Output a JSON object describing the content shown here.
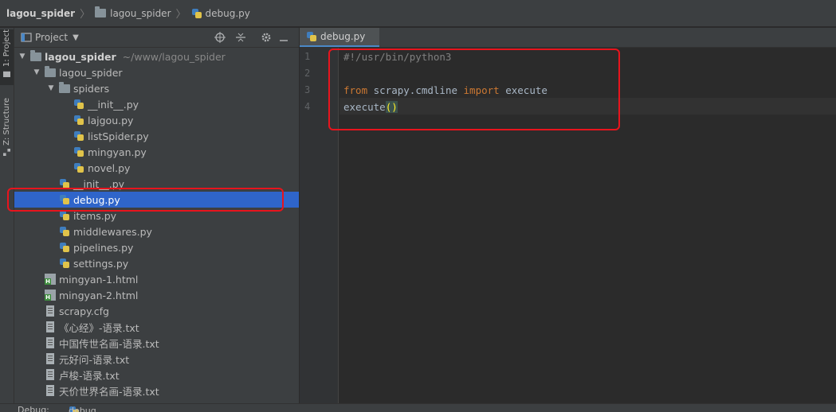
{
  "breadcrumbs": [
    "lagou_spider",
    "lagou_spider",
    "debug.py"
  ],
  "toolstrip": {
    "project_tab": "1: Project",
    "structure_tab": "Z: Structure"
  },
  "panel": {
    "title": "Project",
    "dropdown": "▼"
  },
  "tree": [
    {
      "label": "lagou_spider",
      "hint": "~/www/lagou_spider",
      "depth": 0,
      "type": "folder",
      "expanded": true
    },
    {
      "label": "lagou_spider",
      "depth": 1,
      "type": "folder",
      "expanded": true
    },
    {
      "label": "spiders",
      "depth": 2,
      "type": "folder",
      "expanded": true
    },
    {
      "label": "__init__.py",
      "depth": 3,
      "type": "py"
    },
    {
      "label": "lajgou.py",
      "depth": 3,
      "type": "py"
    },
    {
      "label": "listSpider.py",
      "depth": 3,
      "type": "py"
    },
    {
      "label": "mingyan.py",
      "depth": 3,
      "type": "py"
    },
    {
      "label": "novel.py",
      "depth": 3,
      "type": "py"
    },
    {
      "label": "__init__.py",
      "depth": 2,
      "type": "py"
    },
    {
      "label": "debug.py",
      "depth": 2,
      "type": "py",
      "selected": true
    },
    {
      "label": "items.py",
      "depth": 2,
      "type": "py"
    },
    {
      "label": "middlewares.py",
      "depth": 2,
      "type": "py"
    },
    {
      "label": "pipelines.py",
      "depth": 2,
      "type": "py"
    },
    {
      "label": "settings.py",
      "depth": 2,
      "type": "py"
    },
    {
      "label": "mingyan-1.html",
      "depth": 1,
      "type": "html"
    },
    {
      "label": "mingyan-2.html",
      "depth": 1,
      "type": "html"
    },
    {
      "label": "scrapy.cfg",
      "depth": 1,
      "type": "txt"
    },
    {
      "label": "《心经》-语录.txt",
      "depth": 1,
      "type": "txt"
    },
    {
      "label": "中国传世名画-语录.txt",
      "depth": 1,
      "type": "txt"
    },
    {
      "label": "元好问-语录.txt",
      "depth": 1,
      "type": "txt"
    },
    {
      "label": "卢梭-语录.txt",
      "depth": 1,
      "type": "txt"
    },
    {
      "label": "天价世界名画-语录.txt",
      "depth": 1,
      "type": "txt"
    }
  ],
  "editor": {
    "tab_label": "debug.py",
    "line_numbers": [
      "1",
      "2",
      "3",
      "4"
    ],
    "lines": [
      {
        "parts": [
          {
            "text": "#!/usr/bin/python3",
            "cls": "cm"
          }
        ]
      },
      {
        "parts": []
      },
      {
        "parts": [
          {
            "text": "from",
            "cls": "kw"
          },
          {
            "text": " scrapy.cmdline ",
            "cls": ""
          },
          {
            "text": "import",
            "cls": "kw"
          },
          {
            "text": " execute",
            "cls": ""
          }
        ]
      },
      {
        "parts": [
          {
            "text": "execute",
            "cls": ""
          },
          {
            "text": "()",
            "cls": "brace"
          }
        ]
      }
    ]
  },
  "bottom": {
    "label": "Debug:",
    "config": "debug"
  },
  "colors": {
    "selection": "#2f65ca",
    "highlight_box": "#e8141d",
    "keyword": "#cc7832",
    "comment": "#808080"
  }
}
